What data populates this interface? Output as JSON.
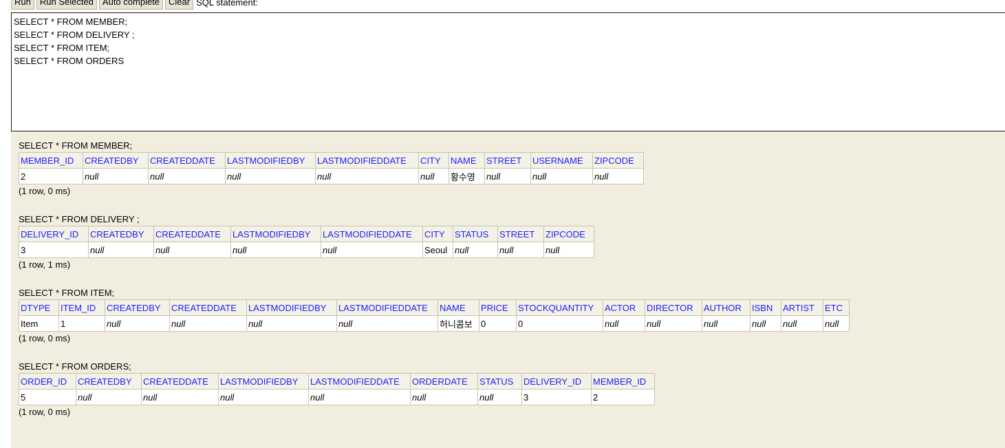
{
  "toolbar": {
    "run_label": "Run",
    "run_selected_label": "Run Selected",
    "auto_complete_label": "Auto complete",
    "clear_label": "Clear",
    "sql_statement_label": "SQL statement:"
  },
  "editor": {
    "text": "SELECT * FROM MEMBER;\nSELECT * FROM DELIVERY ;\nSELECT * FROM ITEM;\nSELECT * FROM ORDERS"
  },
  "results": [
    {
      "statement": "SELECT * FROM MEMBER;",
      "columns": [
        "MEMBER_ID",
        "CREATEDBY",
        "CREATEDDATE",
        "LASTMODIFIEDBY",
        "LASTMODIFIEDDATE",
        "CITY",
        "NAME",
        "STREET",
        "USERNAME",
        "ZIPCODE"
      ],
      "widths": [
        93,
        95,
        112,
        131,
        150,
        44,
        52,
        67,
        90,
        74
      ],
      "rows": [
        [
          "2",
          "null",
          "null",
          "null",
          "null",
          "null",
          "황수영",
          "null",
          "null",
          "null"
        ]
      ],
      "status": "(1 row, 0 ms)"
    },
    {
      "statement": "SELECT * FROM DELIVERY ;",
      "columns": [
        "DELIVERY_ID",
        "CREATEDBY",
        "CREATEDDATE",
        "LASTMODIFIEDBY",
        "LASTMODIFIEDDATE",
        "CITY",
        "STATUS",
        "STREET",
        "ZIPCODE"
      ],
      "widths": [
        101,
        95,
        112,
        131,
        148,
        44,
        65,
        67,
        73
      ],
      "rows": [
        [
          "3",
          "null",
          "null",
          "null",
          "null",
          "Seoul",
          "null",
          "null",
          "null"
        ]
      ],
      "status": "(1 row, 1 ms)"
    },
    {
      "statement": "SELECT * FROM ITEM;",
      "columns": [
        "DTYPE",
        "ITEM_ID",
        "CREATEDBY",
        "CREATEDDATE",
        "LASTMODIFIEDBY",
        "LASTMODIFIEDDATE",
        "NAME",
        "PRICE",
        "STOCKQUANTITY",
        "ACTOR",
        "DIRECTOR",
        "AUTHOR",
        "ISBN",
        "ARTIST",
        "ETC"
      ],
      "widths": [
        58,
        67,
        94,
        112,
        131,
        147,
        60,
        54,
        126,
        61,
        83,
        70,
        45,
        61,
        38
      ],
      "rows": [
        [
          "Item",
          "1",
          "null",
          "null",
          "null",
          "null",
          "허니콤보",
          "0",
          "0",
          "null",
          "null",
          "null",
          "null",
          "null",
          "null"
        ]
      ],
      "status": "(1 row, 0 ms)"
    },
    {
      "statement": "SELECT * FROM ORDERS;",
      "columns": [
        "ORDER_ID",
        "CREATEDBY",
        "CREATEDDATE",
        "LASTMODIFIEDBY",
        "LASTMODIFIEDDATE",
        "ORDERDATE",
        "STATUS",
        "DELIVERY_ID",
        "MEMBER_ID"
      ],
      "widths": [
        83,
        95,
        112,
        131,
        148,
        98,
        64,
        101,
        92
      ],
      "rows": [
        [
          "5",
          "null",
          "null",
          "null",
          "null",
          "null",
          "null",
          "3",
          "2"
        ]
      ],
      "status": "(1 row, 0 ms)"
    }
  ]
}
